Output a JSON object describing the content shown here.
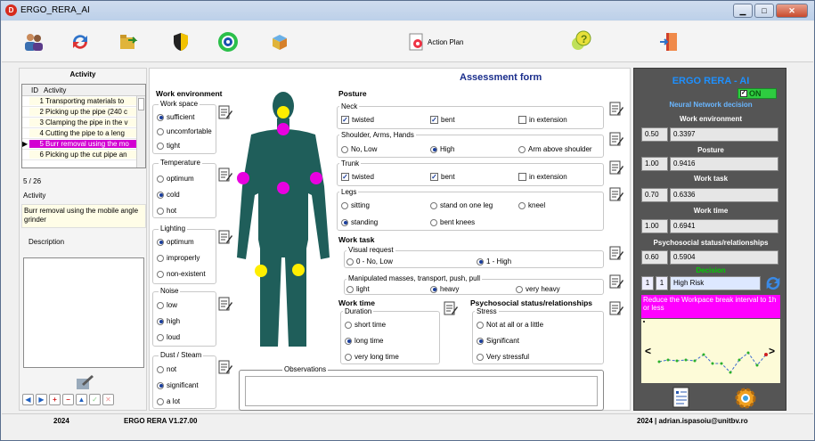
{
  "window": {
    "title": "ERGO_RERA_AI",
    "app_icon": "D"
  },
  "toolbar": {
    "action_plan": "Action Plan"
  },
  "activity": {
    "header": "Activity",
    "col_id": "ID",
    "col_activity": "Activity",
    "rows": [
      {
        "id": "1",
        "activity": "Transporting materials to"
      },
      {
        "id": "2",
        "activity": "Picking up the pipe (240 c"
      },
      {
        "id": "3",
        "activity": "Clamping the pipe in the v"
      },
      {
        "id": "4",
        "activity": "Cutting the pipe to a leng"
      },
      {
        "id": "5",
        "activity": "Burr removal using the mo"
      },
      {
        "id": "6",
        "activity": "Picking up the cut pipe an"
      }
    ],
    "counter": "5 / 26",
    "activity_label": "Activity",
    "activity_value": "Burr removal using the mobile angle grinder",
    "description_label": "Description"
  },
  "form": {
    "title": "Assessment form",
    "work_env": {
      "label": "Work environment",
      "workspace": {
        "label": "Work space",
        "options": [
          "sufficient",
          "uncomfortable",
          "tight"
        ]
      },
      "temperature": {
        "label": "Temperature",
        "options": [
          "optimum",
          "cold",
          "hot"
        ]
      },
      "lighting": {
        "label": "Lighting",
        "options": [
          "optimum",
          "improperly",
          "non-existent"
        ]
      },
      "noise": {
        "label": "Noise",
        "options": [
          "low",
          "high",
          "loud"
        ]
      },
      "dust": {
        "label": "Dust / Steam",
        "options": [
          "not",
          "significant",
          "a lot"
        ]
      }
    },
    "posture": {
      "label": "Posture",
      "neck": {
        "label": "Neck",
        "options": [
          "twisted",
          "bent",
          "in extension"
        ]
      },
      "shoulder": {
        "label": "Shoulder, Arms, Hands",
        "options": [
          "No, Low",
          "High",
          "Arm above shoulder"
        ]
      },
      "trunk": {
        "label": "Trunk",
        "options": [
          "twisted",
          "bent",
          "in extension"
        ]
      },
      "legs": {
        "label": "Legs",
        "options": [
          "sitting",
          "stand on one leg",
          "kneel",
          "standing",
          "bent knees"
        ]
      }
    },
    "work_task": {
      "label": "Work task",
      "visual": {
        "label": "Visual request",
        "options": [
          "0 - No, Low",
          "1 - High"
        ]
      },
      "manip": {
        "label": "Manipulated masses, transport, push, pull",
        "options": [
          "light",
          "heavy",
          "very heavy"
        ]
      }
    },
    "work_time": {
      "label": "Work time",
      "sub": "Duration",
      "options": [
        "short time",
        "long time",
        "very long time"
      ]
    },
    "psycho": {
      "label": "Psychosocial status/relationships",
      "sub": "Stress",
      "options": [
        "Not at all or a little",
        "Significant",
        "Very stressful"
      ]
    },
    "observations": "Observations"
  },
  "ai": {
    "title": "ERGO RERA - AI",
    "on_label": "ON",
    "nn_label": "Neural Network decision",
    "work_env": {
      "label": "Work environment",
      "a": "0.50",
      "b": "0.3397"
    },
    "posture": {
      "label": "Posture",
      "a": "1.00",
      "b": "0.9416"
    },
    "work_task": {
      "label": "Work task",
      "a": "0.70",
      "b": "0.6336"
    },
    "work_time": {
      "label": "Work time",
      "a": "1.00",
      "b": "0.6941"
    },
    "psycho": {
      "label": "Psychosocial status/relationships",
      "a": "0.60",
      "b": "0.5904"
    },
    "decision": {
      "label": "Decision",
      "n1": "1",
      "n2": "1",
      "value": "High Risk"
    },
    "recommendation": "Reduce the Workpace break interval to 1h or less",
    "chart_prev": "<",
    "chart_next": ">"
  },
  "status": {
    "year": "2024",
    "version": "ERGO RERA V1.27.00",
    "contact": "2024 | adrian.ispasoiu@unitbv.ro"
  },
  "colors": {
    "selected": "#d200d2",
    "ai_title": "#1e90ff",
    "panel": "#555555",
    "on_green": "#2ecc40",
    "decision_green": "#00d000",
    "figure": "#1f5e5a"
  }
}
